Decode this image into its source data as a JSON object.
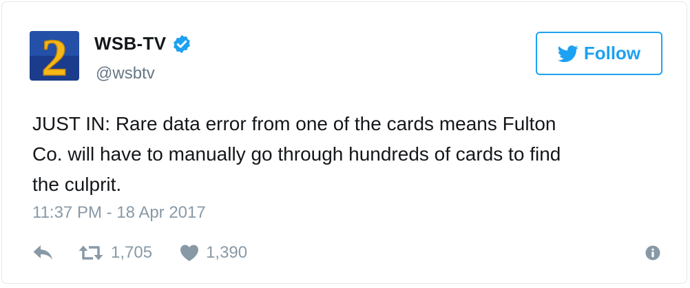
{
  "user": {
    "display_name": "WSB-TV",
    "handle": "@wsbtv",
    "verified": true,
    "avatar_icon": "wsb-channel-2-logo",
    "avatar_text": "2"
  },
  "follow_button": {
    "label": "Follow",
    "icon": "twitter-bird-icon"
  },
  "tweet": {
    "lines": [
      "JUST IN: Rare data error from one of the cards means Fulton",
      "Co. will have to manually go through hundreds of cards to find",
      "the culprit."
    ],
    "timestamp": "11:37 PM - 18 Apr 2017"
  },
  "actions": {
    "reply_icon": "reply-icon",
    "retweet_icon": "retweet-icon",
    "retweet_count": "1,705",
    "like_icon": "heart-icon",
    "like_count": "1,390",
    "info_icon": "info-icon"
  },
  "colors": {
    "accent": "#1da1f2",
    "muted": "#8899a6",
    "handle": "#657786",
    "text": "#14171a",
    "border": "#e1e8ed",
    "avatar_bg": "#1b3c8c",
    "avatar_numeral": "#f6b817"
  }
}
